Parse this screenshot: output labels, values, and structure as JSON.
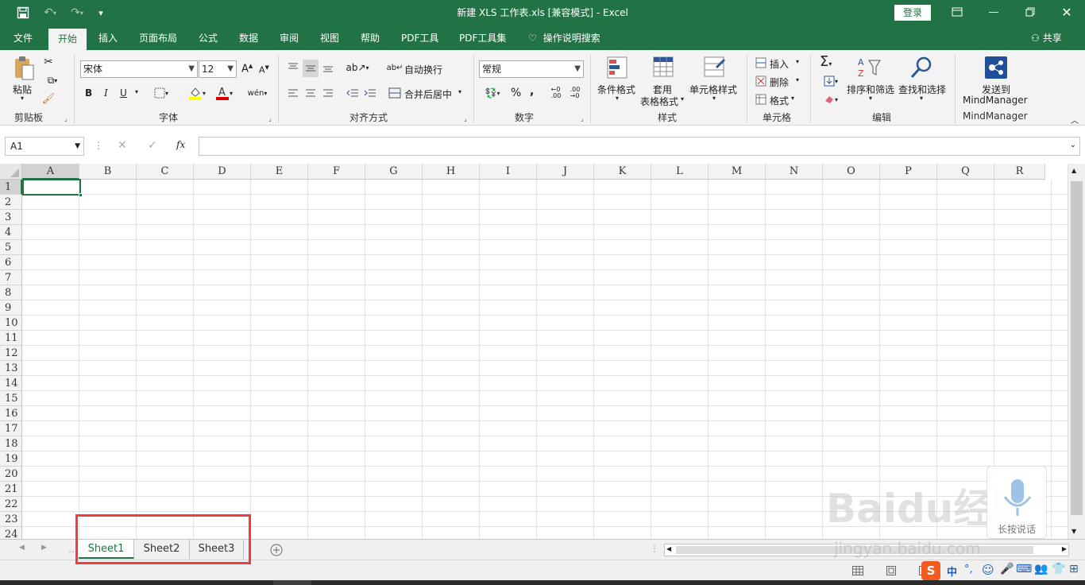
{
  "window": {
    "title": "新建 XLS 工作表.xls  [兼容模式]  -  Excel",
    "login_label": "登录"
  },
  "tabs": [
    "文件",
    "开始",
    "插入",
    "页面布局",
    "公式",
    "数据",
    "审阅",
    "视图",
    "帮助",
    "PDF工具",
    "PDF工具集",
    "操作说明搜索"
  ],
  "share_label": "共享",
  "ribbon": {
    "clipboard": {
      "paste": "粘贴",
      "label": "剪贴板"
    },
    "font": {
      "name": "宋体",
      "size": "12",
      "bold": "B",
      "italic": "I",
      "underline": "U",
      "label": "字体"
    },
    "alignment": {
      "wrap": "自动换行",
      "merge": "合并后居中",
      "label": "对齐方式"
    },
    "number": {
      "format": "常规",
      "percent": "%",
      "comma": ",",
      "label": "数字"
    },
    "styles": {
      "conditional": "条件格式",
      "table_l1": "套用",
      "table_l2": "表格格式",
      "cell_styles": "单元格样式",
      "label": "样式"
    },
    "cells": {
      "insert": "插入",
      "delete": "删除",
      "format": "格式",
      "label": "单元格"
    },
    "editing": {
      "sort": "排序和筛选",
      "find": "查找和选择",
      "label": "编辑"
    },
    "mindmanager": {
      "send_l1": "发送到",
      "send_l2": "MindManager",
      "label": "MindManager"
    }
  },
  "formula_bar": {
    "name_box": "A1",
    "fx": "fx",
    "formula": ""
  },
  "columns": [
    "A",
    "B",
    "C",
    "D",
    "E",
    "F",
    "G",
    "H",
    "I",
    "J",
    "K",
    "L",
    "M",
    "N",
    "O",
    "P",
    "Q",
    "R"
  ],
  "rows": [
    "1",
    "2",
    "3",
    "4",
    "5",
    "6",
    "7",
    "8",
    "9",
    "10",
    "11",
    "12",
    "13",
    "14",
    "15",
    "16",
    "17",
    "18",
    "19",
    "20",
    "21",
    "22",
    "23",
    "24"
  ],
  "sheets": [
    "Sheet1",
    "Sheet2",
    "Sheet3"
  ],
  "active_sheet": "Sheet1",
  "status": {
    "ime": "中"
  },
  "overlay": {
    "voice_label": "长按说话",
    "watermark": "Baidu经验",
    "watermark_url": "jingyan.baidu.com"
  },
  "colors": {
    "excel_green": "#217346",
    "highlight_red": "#f03c3c"
  }
}
